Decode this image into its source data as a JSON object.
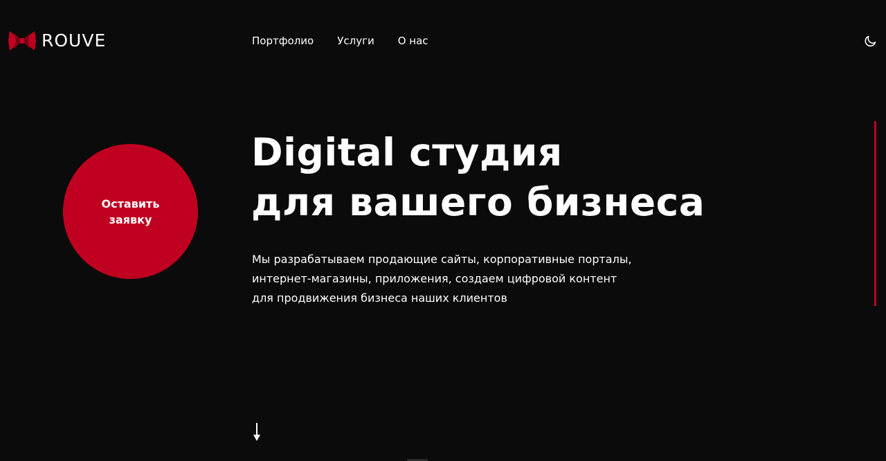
{
  "header": {
    "logo_text": "ROUVE",
    "logo_icon": "bow-logo-icon",
    "nav": [
      {
        "label": "Портфолио"
      },
      {
        "label": "Услуги"
      },
      {
        "label": "О нас"
      }
    ],
    "theme_toggle_icon": "moon-icon"
  },
  "cta": {
    "label": "Оставить заявку"
  },
  "hero": {
    "title_line1": "Digital студия",
    "title_line2": "для вашего бизнеса",
    "description_lines": [
      "Мы разрабатываем продающие сайты, корпоративные порталы,",
      "интернет-магазины, приложения, создаем цифровой контент",
      "для продвижения бизнеса наших клиентов"
    ]
  },
  "scroll": {
    "icon": "arrow-down-icon"
  },
  "colors": {
    "background": "#0c0b0b",
    "accent": "#c00020",
    "text": "#ffffff"
  }
}
